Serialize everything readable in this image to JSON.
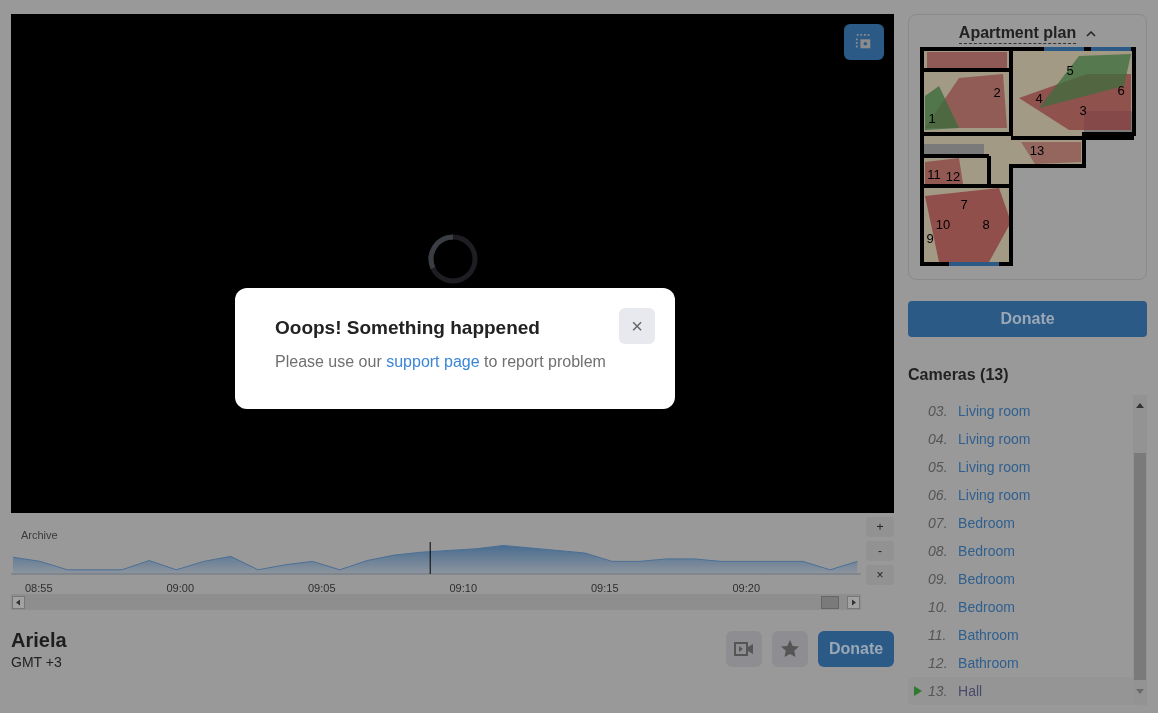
{
  "player": {
    "timeline": {
      "label": "Archive",
      "ticks": [
        "08:55",
        "09:00",
        "09:05",
        "09:10",
        "09:15",
        "09:20"
      ],
      "zoom_buttons": [
        "+",
        "-",
        "×"
      ]
    },
    "camera_name": "Ariela",
    "timezone": "GMT +3",
    "donate": "Donate"
  },
  "dialog": {
    "title": "Ooops! Something happened",
    "message_before": "Please use our ",
    "link": "support page",
    "message_after": " to report problem",
    "close": "×"
  },
  "plan": {
    "title": "Apartment plan",
    "expanded": true,
    "camera_numbers": [
      "1",
      "2",
      "3",
      "4",
      "5",
      "6",
      "7",
      "8",
      "9",
      "10",
      "11",
      "12",
      "13"
    ]
  },
  "donate": "Donate",
  "cameras": {
    "title": "Cameras (13)",
    "items": [
      {
        "number": "03.",
        "name": "Living room",
        "selected": false
      },
      {
        "number": "04.",
        "name": "Living room",
        "selected": false
      },
      {
        "number": "05.",
        "name": "Living room",
        "selected": false
      },
      {
        "number": "06.",
        "name": "Living room",
        "selected": false
      },
      {
        "number": "07.",
        "name": "Bedroom",
        "selected": false
      },
      {
        "number": "08.",
        "name": "Bedroom",
        "selected": false
      },
      {
        "number": "09.",
        "name": "Bedroom",
        "selected": false
      },
      {
        "number": "10.",
        "name": "Bedroom",
        "selected": false
      },
      {
        "number": "11.",
        "name": "Bathroom",
        "selected": false
      },
      {
        "number": "12.",
        "name": "Bathroom",
        "selected": false
      },
      {
        "number": "13.",
        "name": "Hall",
        "selected": true
      }
    ]
  }
}
